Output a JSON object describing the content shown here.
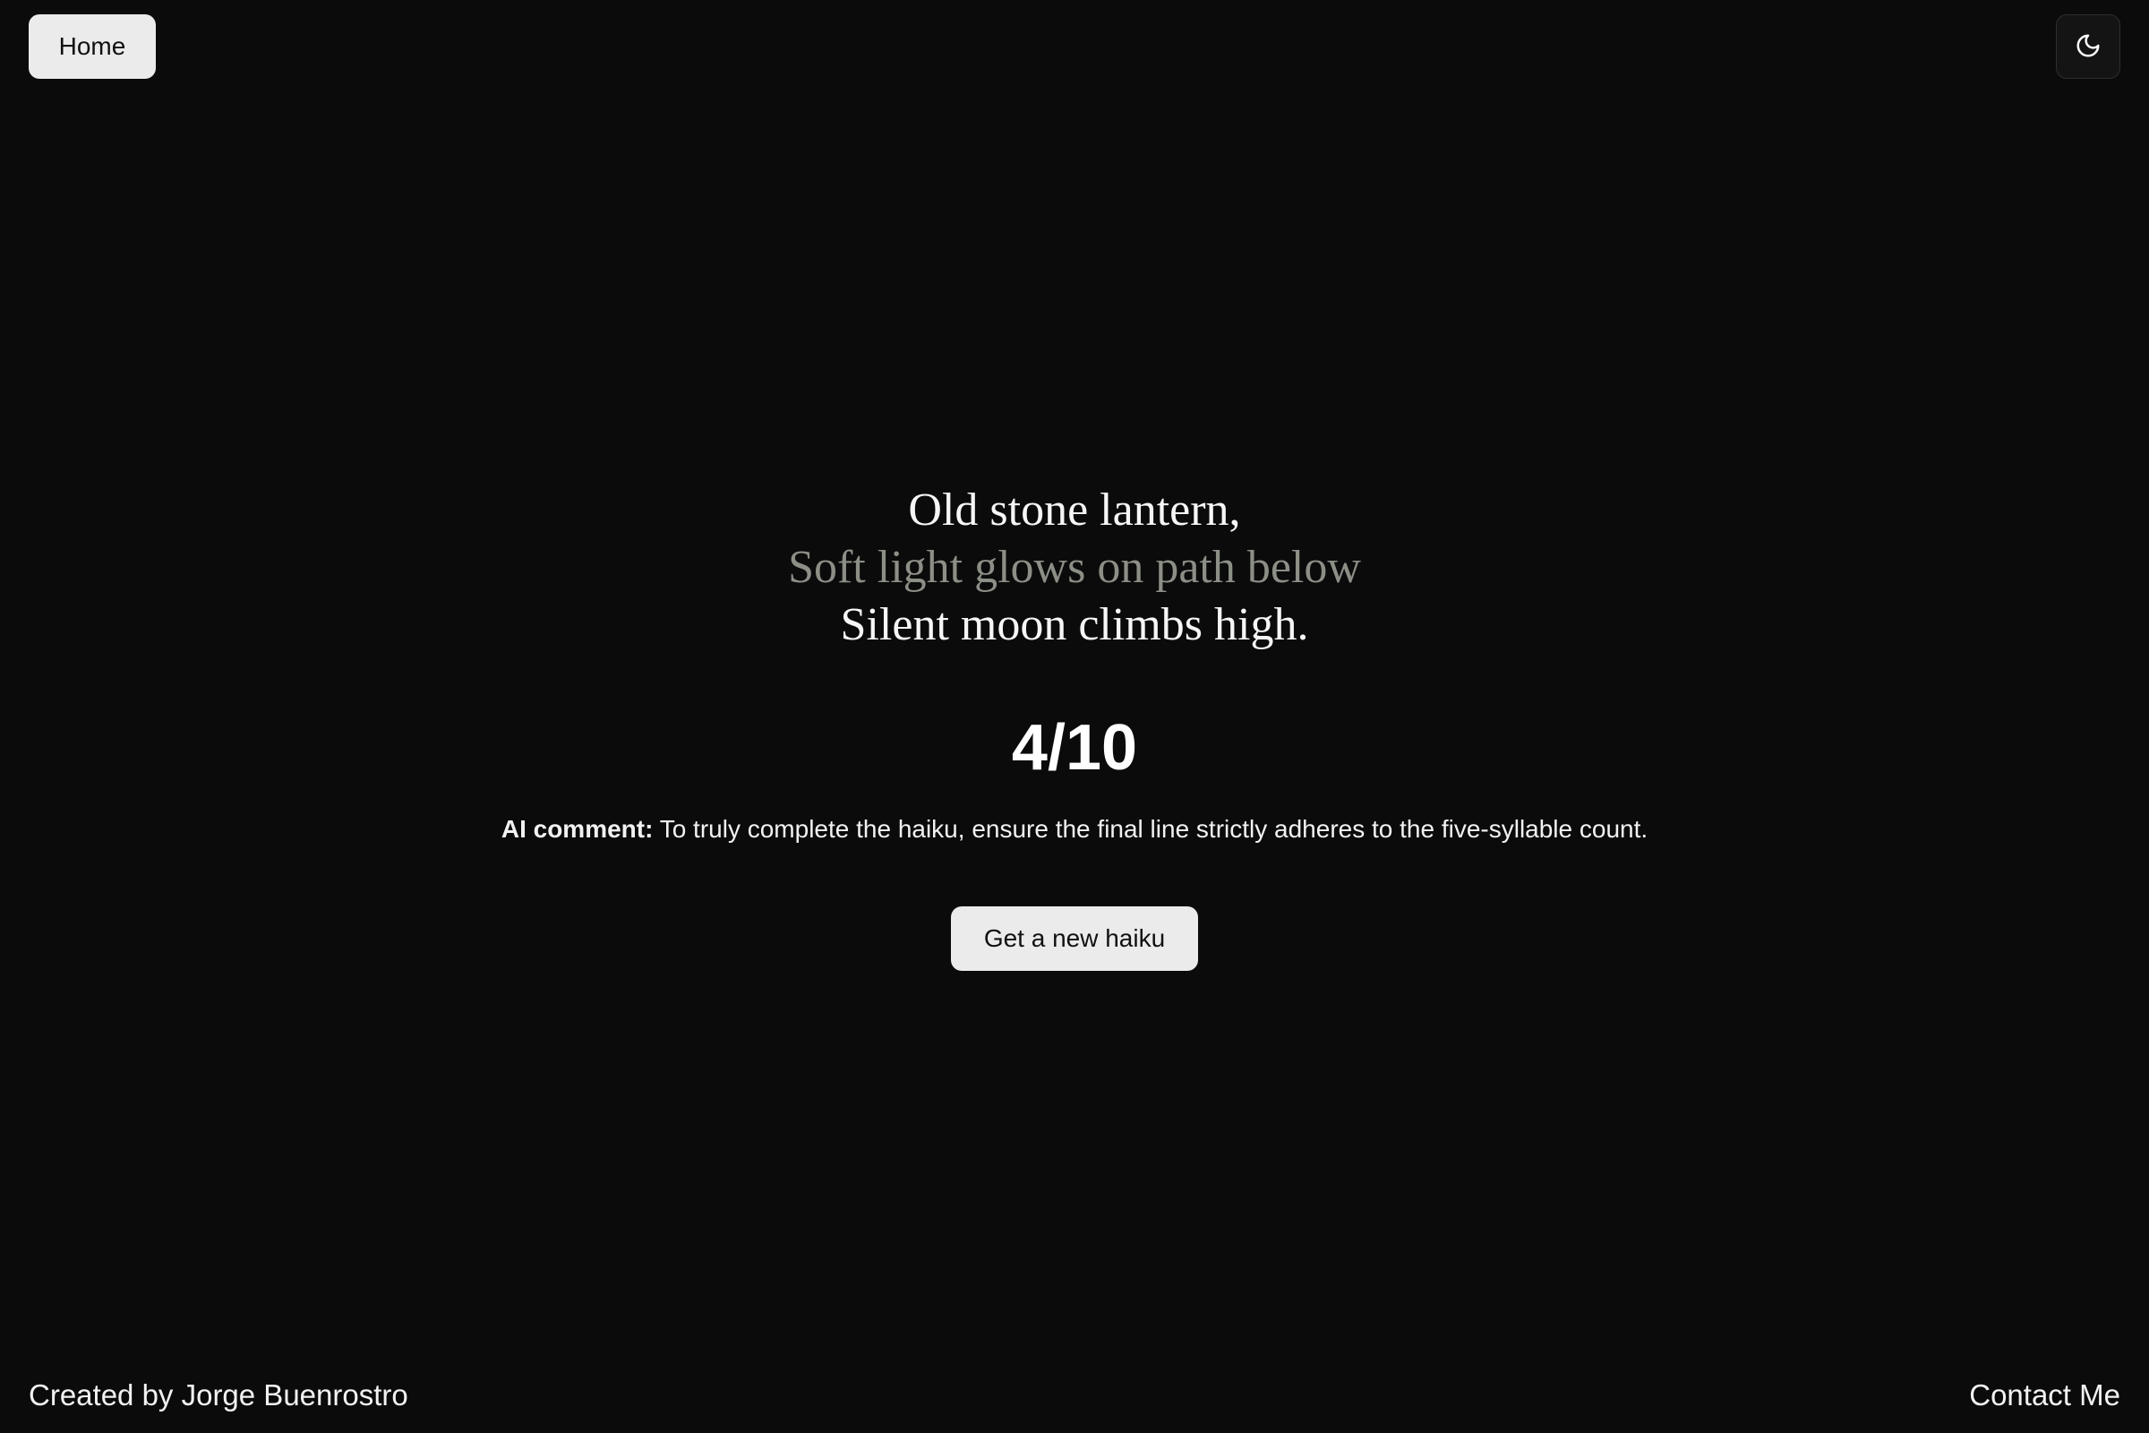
{
  "nav": {
    "home_label": "Home",
    "theme_toggle_icon": "moon-icon"
  },
  "haiku": {
    "lines": [
      "Old stone lantern,",
      "Soft light glows on path below",
      "Silent moon climbs high."
    ]
  },
  "score": {
    "text": "4/10"
  },
  "ai_comment": {
    "label": "AI comment:",
    "text": " To truly complete the haiku, ensure the final line strictly adheres to the five-syllable count."
  },
  "actions": {
    "new_haiku_label": "Get a new haiku"
  },
  "footer": {
    "credit": "Created by Jorge Buenrostro",
    "contact_label": "Contact Me"
  },
  "colors": {
    "background": "#0b0b0b",
    "button_bg": "#ebebeb",
    "muted_line": "#8b8f86",
    "text": "#ffffff"
  }
}
